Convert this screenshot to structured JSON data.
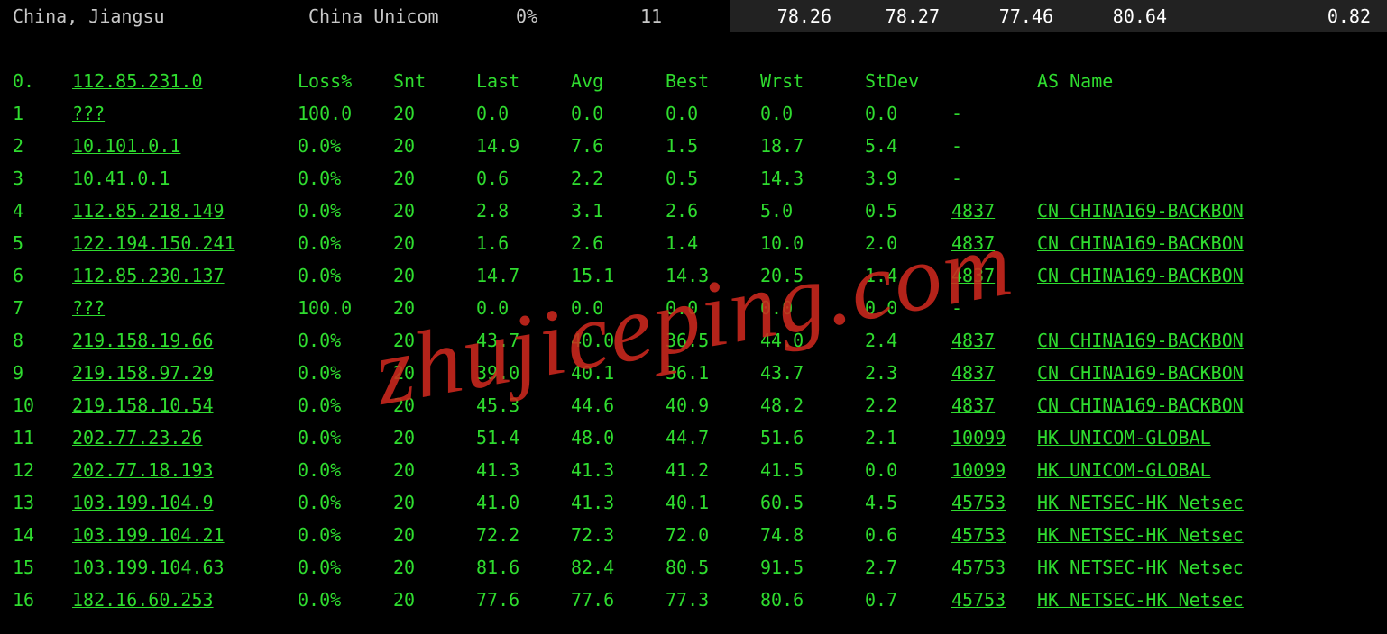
{
  "status": {
    "location": "China, Jiangsu",
    "isp": "China Unicom",
    "loss": "0%",
    "count": "11",
    "v1": "78.26",
    "v2": "78.27",
    "v3": "77.46",
    "v4": "80.64",
    "v5": "0.82"
  },
  "headers": {
    "hop": "0.",
    "host": "112.85.231.0",
    "loss": "Loss%",
    "snt": "Snt",
    "last": "Last",
    "avg": "Avg",
    "best": "Best",
    "wrst": "Wrst",
    "stdev": "StDev",
    "asname": "AS Name"
  },
  "hops": [
    {
      "n": "1",
      "host": "???",
      "loss": "100.0",
      "snt": "20",
      "last": "0.0",
      "avg": "0.0",
      "best": "0.0",
      "wrst": "0.0",
      "stdev": "0.0",
      "asn": "",
      "asname": "-"
    },
    {
      "n": "2",
      "host": "10.101.0.1",
      "loss": "0.0%",
      "snt": "20",
      "last": "14.9",
      "avg": "7.6",
      "best": "1.5",
      "wrst": "18.7",
      "stdev": "5.4",
      "asn": "",
      "asname": "-"
    },
    {
      "n": "3",
      "host": "10.41.0.1",
      "loss": "0.0%",
      "snt": "20",
      "last": "0.6",
      "avg": "2.2",
      "best": "0.5",
      "wrst": "14.3",
      "stdev": "3.9",
      "asn": "",
      "asname": "-"
    },
    {
      "n": "4",
      "host": "112.85.218.149",
      "loss": "0.0%",
      "snt": "20",
      "last": "2.8",
      "avg": "3.1",
      "best": "2.6",
      "wrst": "5.0",
      "stdev": "0.5",
      "asn": "4837",
      "asname": "CN CHINA169-BACKBON"
    },
    {
      "n": "5",
      "host": "122.194.150.241",
      "loss": "0.0%",
      "snt": "20",
      "last": "1.6",
      "avg": "2.6",
      "best": "1.4",
      "wrst": "10.0",
      "stdev": "2.0",
      "asn": "4837",
      "asname": "CN CHINA169-BACKBON"
    },
    {
      "n": "6",
      "host": "112.85.230.137",
      "loss": "0.0%",
      "snt": "20",
      "last": "14.7",
      "avg": "15.1",
      "best": "14.3",
      "wrst": "20.5",
      "stdev": "1.4",
      "asn": "4837",
      "asname": "CN CHINA169-BACKBON"
    },
    {
      "n": "7",
      "host": "???",
      "loss": "100.0",
      "snt": "20",
      "last": "0.0",
      "avg": "0.0",
      "best": "0.0",
      "wrst": "0.0",
      "stdev": "0.0",
      "asn": "",
      "asname": "-"
    },
    {
      "n": "8",
      "host": "219.158.19.66",
      "loss": "0.0%",
      "snt": "20",
      "last": "43.7",
      "avg": "40.0",
      "best": "36.5",
      "wrst": "44.0",
      "stdev": "2.4",
      "asn": "4837",
      "asname": "CN CHINA169-BACKBON"
    },
    {
      "n": "9",
      "host": "219.158.97.29",
      "loss": "0.0%",
      "snt": "20",
      "last": "39.0",
      "avg": "40.1",
      "best": "36.1",
      "wrst": "43.7",
      "stdev": "2.3",
      "asn": "4837",
      "asname": "CN CHINA169-BACKBON"
    },
    {
      "n": "10",
      "host": "219.158.10.54",
      "loss": "0.0%",
      "snt": "20",
      "last": "45.3",
      "avg": "44.6",
      "best": "40.9",
      "wrst": "48.2",
      "stdev": "2.2",
      "asn": "4837",
      "asname": "CN CHINA169-BACKBON"
    },
    {
      "n": "11",
      "host": "202.77.23.26",
      "loss": "0.0%",
      "snt": "20",
      "last": "51.4",
      "avg": "48.0",
      "best": "44.7",
      "wrst": "51.6",
      "stdev": "2.1",
      "asn": "10099",
      "asname": "HK UNICOM-GLOBAL"
    },
    {
      "n": "12",
      "host": "202.77.18.193",
      "loss": "0.0%",
      "snt": "20",
      "last": "41.3",
      "avg": "41.3",
      "best": "41.2",
      "wrst": "41.5",
      "stdev": "0.0",
      "asn": "10099",
      "asname": "HK UNICOM-GLOBAL"
    },
    {
      "n": "13",
      "host": "103.199.104.9",
      "loss": "0.0%",
      "snt": "20",
      "last": "41.0",
      "avg": "41.3",
      "best": "40.1",
      "wrst": "60.5",
      "stdev": "4.5",
      "asn": "45753",
      "asname": "HK NETSEC-HK Netsec"
    },
    {
      "n": "14",
      "host": "103.199.104.21",
      "loss": "0.0%",
      "snt": "20",
      "last": "72.2",
      "avg": "72.3",
      "best": "72.0",
      "wrst": "74.8",
      "stdev": "0.6",
      "asn": "45753",
      "asname": "HK NETSEC-HK Netsec"
    },
    {
      "n": "15",
      "host": "103.199.104.63",
      "loss": "0.0%",
      "snt": "20",
      "last": "81.6",
      "avg": "82.4",
      "best": "80.5",
      "wrst": "91.5",
      "stdev": "2.7",
      "asn": "45753",
      "asname": "HK NETSEC-HK Netsec"
    },
    {
      "n": "16",
      "host": "182.16.60.253",
      "loss": "0.0%",
      "snt": "20",
      "last": "77.6",
      "avg": "77.6",
      "best": "77.3",
      "wrst": "80.6",
      "stdev": "0.7",
      "asn": "45753",
      "asname": "HK NETSEC-HK Netsec"
    }
  ],
  "watermark": "zhujiceping.com"
}
